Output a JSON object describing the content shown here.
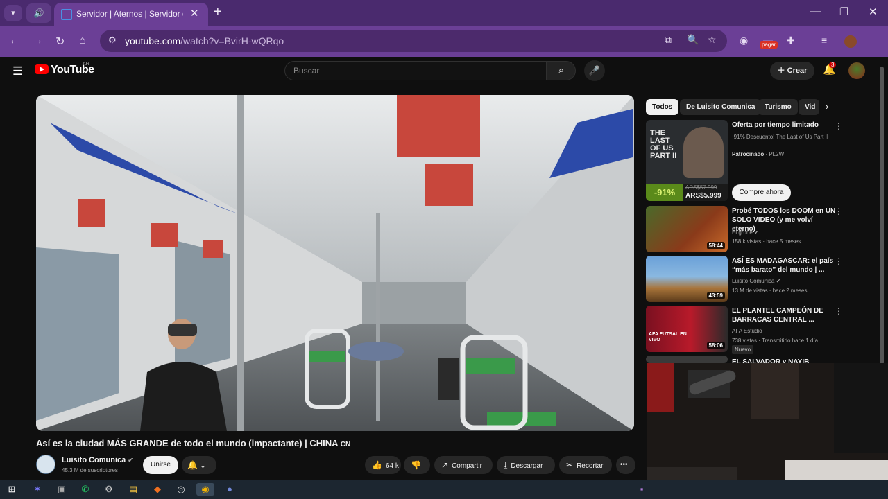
{
  "browser": {
    "tab_title": "Servidor | Aternos | Servidor de Minecraft gratis",
    "url_host": "youtube.com",
    "url_path": "/watch?v=BvirH-wQRqo",
    "extension_badge": "pagar"
  },
  "header": {
    "logo_text": "YouTube",
    "country": "AR",
    "search_placeholder": "Buscar",
    "create_label": "Crear",
    "notification_count": "3"
  },
  "video": {
    "title": "Así es la ciudad MÁS GRANDE de todo el mundo (impactante) | CHINA",
    "title_flag": "CN",
    "channel_name": "Luisito Comunica",
    "subscribers": "45.3 M de suscriptores",
    "join_label": "Unirse",
    "likes": "64 k",
    "share_label": "Compartir",
    "download_label": "Descargar",
    "clip_label": "Recortar",
    "more_label": "•••"
  },
  "chips": [
    "Todos",
    "De Luisito Comunica",
    "Turismo",
    "Vid"
  ],
  "ad": {
    "title": "Oferta por tiempo limitado",
    "desc": "¡91% Descuento! The Last of Us Part II",
    "sponsor_prefix": "Patrocinado",
    "sponsor": "PL2W",
    "cta": "Compre ahora",
    "discount": "-91%",
    "old_price": "ARS$57.999",
    "new_price": "ARS$5.999",
    "thumb_text": "THE LAST OF US PART II"
  },
  "related": [
    {
      "title": "Probé TODOS los DOOM en UN SOLO VIDEO (y me volví eterno)",
      "channel": "El grone",
      "meta": "158 k vistas · hace 5 meses",
      "duration": "58:44"
    },
    {
      "title": "ASÍ ES MADAGASCAR: el país “más barato” del mundo | ...",
      "channel": "Luisito Comunica",
      "meta": "13 M de vistas · hace 2 meses",
      "duration": "43:59"
    },
    {
      "title": "EL PLANTEL CAMPEÓN DE BARRACAS CENTRAL ...",
      "channel": "AFA Estudio",
      "meta": "738 vistas · Transmitido hace 1 día",
      "duration": "58:06",
      "badge": "Nuevo",
      "thumb_text": "AFA FUTSAL EN VIVO"
    },
    {
      "title": "EL SALVADOR y NAYIB BUKELE..."
    }
  ],
  "colors": {
    "brand_red": "#ff0000",
    "browser_purple": "#6b3f96"
  }
}
